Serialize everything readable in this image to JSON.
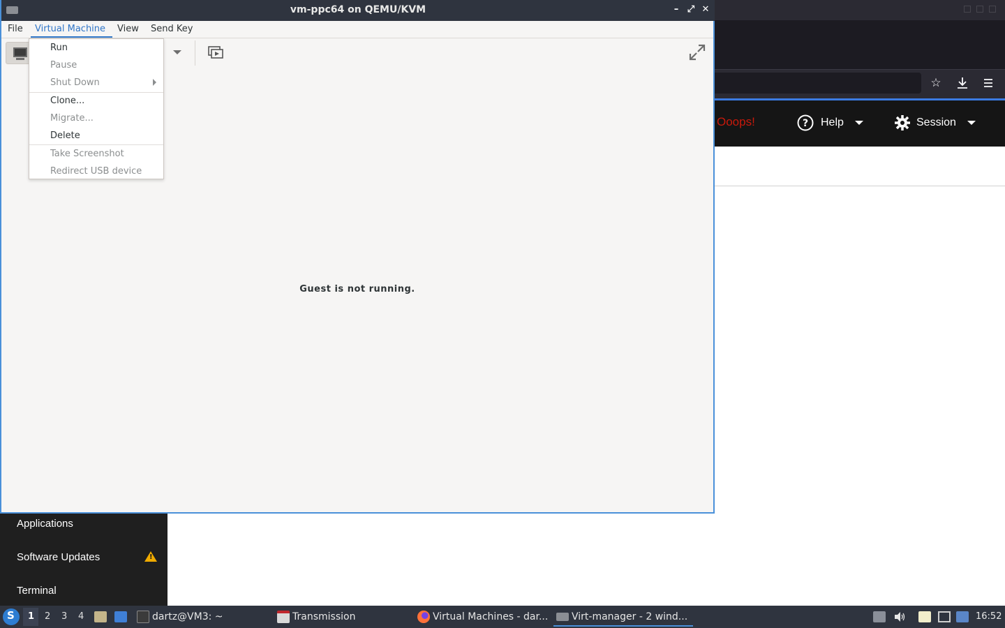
{
  "window": {
    "title": "vm-ppc64 on QEMU/KVM",
    "min_icon": "minimize-icon",
    "max_icon": "maximize-icon",
    "close_icon": "close-icon"
  },
  "menubar": {
    "file": "File",
    "virtual_machine": "Virtual Machine",
    "view": "View",
    "send_key": "Send Key"
  },
  "vm_menu": {
    "items": [
      {
        "label": "Run",
        "enabled": true
      },
      {
        "label": "Pause",
        "enabled": false
      },
      {
        "label": "Shut Down",
        "enabled": false,
        "submenu": true
      },
      {
        "label": "Clone...",
        "enabled": true
      },
      {
        "label": "Migrate...",
        "enabled": false
      },
      {
        "label": "Delete",
        "enabled": true
      },
      {
        "label": "Take Screenshot",
        "enabled": false
      },
      {
        "label": "Redirect USB device",
        "enabled": false
      }
    ]
  },
  "console": {
    "message": "Guest is not running."
  },
  "background_browser": {
    "oops": "Ooops!",
    "help": "Help",
    "session": "Session"
  },
  "background_menu": {
    "items": [
      "Applications",
      "Software Updates",
      "Terminal"
    ]
  },
  "taskbar": {
    "workspaces": [
      "1",
      "2",
      "3",
      "4"
    ],
    "active_workspace": "1",
    "tasks": [
      {
        "label": "dartz@VM3: ~",
        "icon": "terminal-icon"
      },
      {
        "label": "Transmission",
        "icon": "transmission-icon"
      },
      {
        "label": "Virtual Machines - dar...",
        "icon": "firefox-icon"
      },
      {
        "label": "Virt-manager - 2 wind...",
        "icon": "virt-manager-icon"
      }
    ],
    "clock": "16:52"
  },
  "colors": {
    "accent": "#4a90d9",
    "menu_active": "#3076c8",
    "taskbar_bg": "#2f343f",
    "oops_red": "#c9190b",
    "warning": "#f0ab00"
  }
}
